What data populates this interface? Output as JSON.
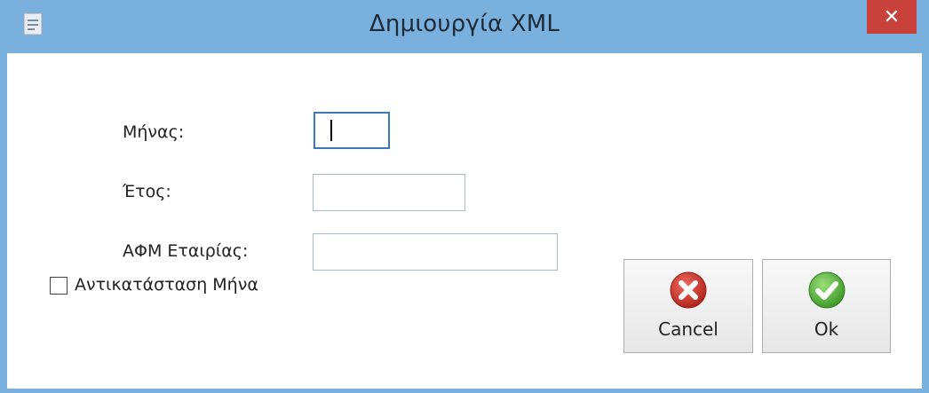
{
  "window": {
    "title": "Δημιουργία XML",
    "close_glyph": "✕",
    "accent": "#79b0de",
    "close_color": "#c8413a"
  },
  "form": {
    "month_label": "Μήνας:",
    "month_value": "",
    "year_label": "Έτος:",
    "year_value": "",
    "vat_label": "ΑΦΜ Εταιρίας:",
    "vat_value": ""
  },
  "options": {
    "replace_month_label": "Αντικατάσταση Μήνα",
    "replace_month_checked": false
  },
  "buttons": {
    "cancel_label": "Cancel",
    "cancel_icon": "cancel-x-icon",
    "ok_label": "Ok",
    "ok_icon": "ok-check-icon"
  }
}
